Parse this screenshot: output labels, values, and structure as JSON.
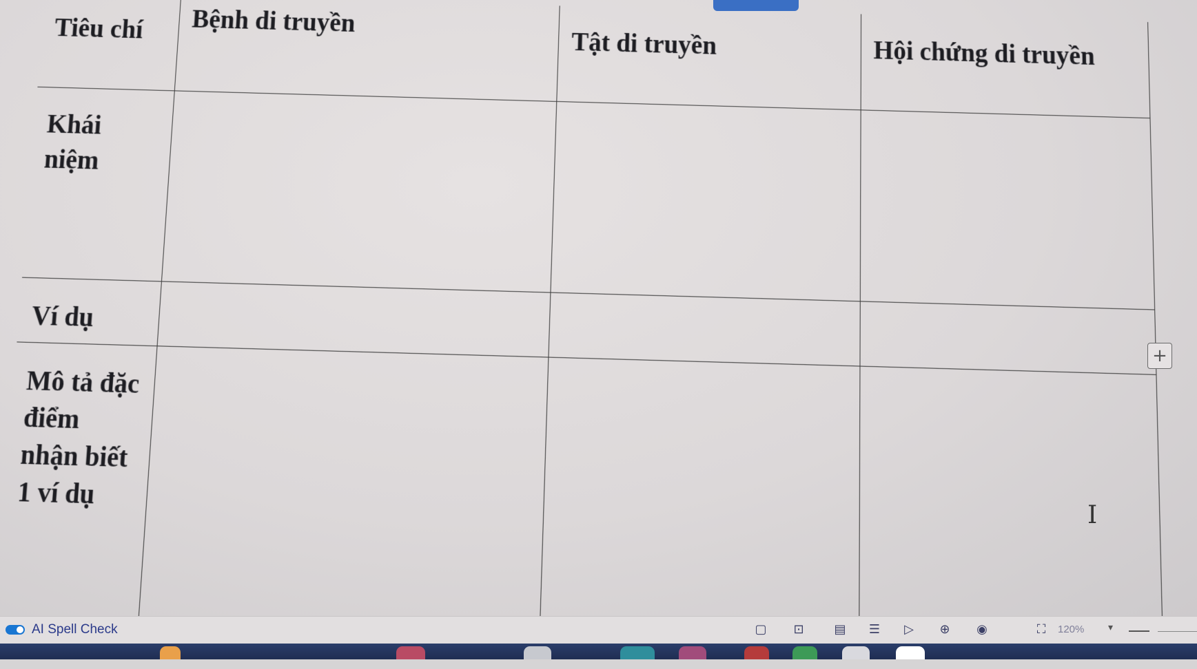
{
  "table": {
    "header": {
      "col0": "Tiêu chí",
      "col1": "Bệnh di truyền",
      "col2": "Tật di truyền",
      "col3": "Hội chứng di truyền"
    },
    "rows": [
      {
        "label": "Khái niệm"
      },
      {
        "label": "Ví dụ"
      },
      {
        "label": "Mô tả đặc điểm nhận biết 1 ví dụ"
      }
    ]
  },
  "add_button": {
    "symbol": "+"
  },
  "statusbar": {
    "spell_check_label": "AI Spell Check",
    "zoom_level": "120%",
    "zoom_caret": "▾"
  },
  "icons": [
    "add-row-icon",
    "text-cursor-icon",
    "spell-toggle-icon",
    "page-icon",
    "page-number-icon",
    "layout-icon",
    "list-icon",
    "play-icon",
    "globe-icon",
    "eye-icon",
    "fullscreen-icon"
  ],
  "colors": {
    "accent": "#1976d2",
    "taskbar": "#1f2d52",
    "grid_line": "#3b3b3b"
  }
}
